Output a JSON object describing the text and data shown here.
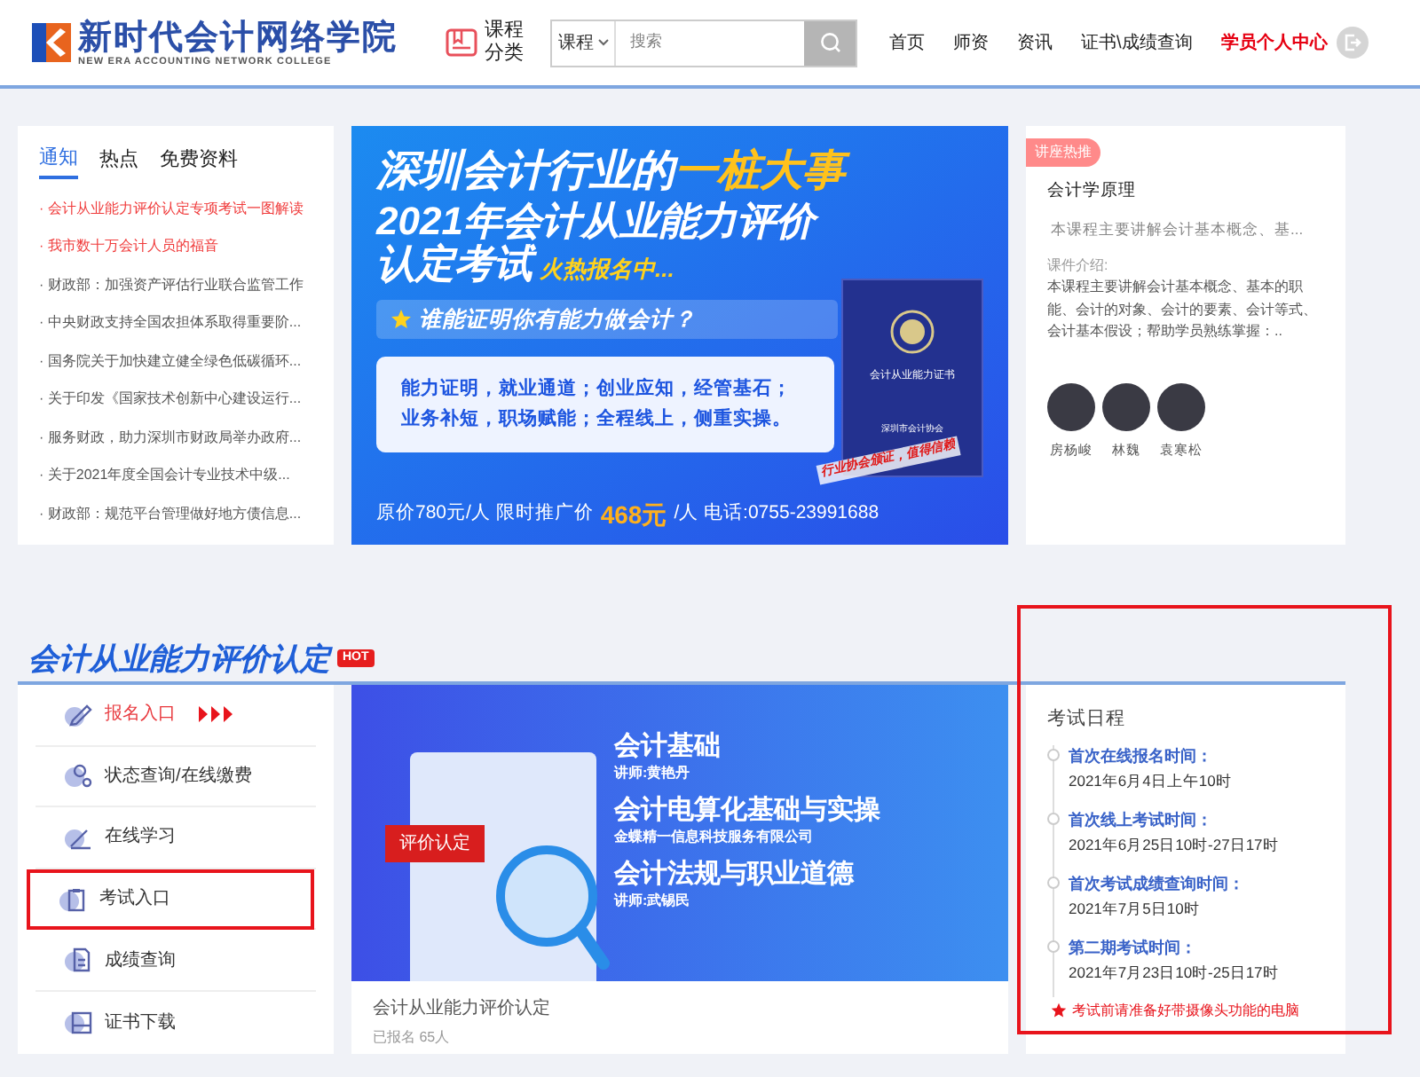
{
  "header": {
    "logo": {
      "name": "新时代会计网络学院",
      "subtitle": "NEW ERA ACCOUNTING NETWORK COLLEGE"
    },
    "category_button": {
      "lines": [
        "课程",
        "分类"
      ]
    },
    "search": {
      "scope": "课程",
      "placeholder": "搜索"
    },
    "nav": [
      {
        "label": "首页",
        "kind": "link"
      },
      {
        "label": "师资",
        "kind": "link"
      },
      {
        "label": "资讯",
        "kind": "link"
      },
      {
        "label": "证书\\成绩查询",
        "kind": "link"
      },
      {
        "label": "学员个人中心",
        "kind": "user"
      }
    ]
  },
  "news": {
    "tabs": [
      {
        "label": "通知",
        "selected": true
      },
      {
        "label": "热点",
        "selected": false
      },
      {
        "label": "免费资料",
        "selected": false
      }
    ],
    "items": [
      {
        "text": "· 会计从业能力评价认定专项考试一图解读",
        "hot": true
      },
      {
        "text": "· 我市数十万会计人员的福音",
        "hot": true
      },
      {
        "text": "· 财政部：加强资产评估行业联合监管工作",
        "hot": false
      },
      {
        "text": "· 中央财政支持全国农担体系取得重要阶...",
        "hot": false
      },
      {
        "text": "· 国务院关于加快建立健全绿色低碳循环...",
        "hot": false
      },
      {
        "text": "· 关于印发《国家技术创新中心建设运行...",
        "hot": false
      },
      {
        "text": "· 服务财政，助力深圳市财政局举办政府...",
        "hot": false
      },
      {
        "text": "· 关于2021年度全国会计专业技术中级...",
        "hot": false
      },
      {
        "text": "· 财政部：规范平台管理做好地方债信息...",
        "hot": false
      }
    ]
  },
  "banner": {
    "headline": "深圳会计行业的",
    "headline_highlight": "一桩大事",
    "line2": "2021年会计从业能力评价",
    "line3": "认定考试",
    "line3_tag": "火热报名中...",
    "question": "谁能证明你有能力做会计？",
    "benefits": [
      "能力证明，就业通道；创业应知，经管基石；",
      "业务补短，职场赋能；全程线上，侧重实操。"
    ],
    "price_before": "原价780元/人 限时推广价",
    "price_highlight": "468元",
    "price_after": "/人 电话:0755-23991688",
    "certificate": {
      "title": "会计从业能力证书",
      "issuer": "深圳市会计协会"
    },
    "stamp": "行业协会颁证，值得信赖"
  },
  "lecture": {
    "tag": "讲座热推",
    "title": "会计学原理",
    "summary": "本课程主要讲解会计基本概念、基...",
    "intro_label": "课件介绍:",
    "intro": "本课程主要讲解会计基本概念、基本的职能、会计的对象、会计的要素、会计等式、会计基本假设；帮助学员熟练掌握：..",
    "teachers": [
      "房杨峻",
      "林魏",
      "袁寒松"
    ]
  },
  "section": {
    "title": "会计从业能力评价认定",
    "badge": "HOT",
    "menu": [
      {
        "label": "报名入口",
        "kind": "primary",
        "highlighted": false
      },
      {
        "label": "状态查询/在线缴费",
        "kind": "normal",
        "highlighted": false
      },
      {
        "label": "在线学习",
        "kind": "normal",
        "highlighted": false
      },
      {
        "label": "考试入口",
        "kind": "normal",
        "highlighted": true
      },
      {
        "label": "成绩查询",
        "kind": "normal",
        "highlighted": false
      },
      {
        "label": "证书下载",
        "kind": "normal",
        "highlighted": false
      }
    ],
    "course": {
      "tag": "评价认定",
      "lines": [
        {
          "title": "会计基础",
          "subtitle": "讲师:黄艳丹"
        },
        {
          "title": "会计电算化基础与实操",
          "subtitle": "金蝶精一信息科技服务有限公司"
        },
        {
          "title": "会计法规与职业道德",
          "subtitle": "讲师:武锡民"
        }
      ],
      "name": "会计从业能力评价认定",
      "enrolled": "已报名 65人"
    },
    "schedule": {
      "title": "考试日程",
      "highlighted": true,
      "items": [
        {
          "label": "首次在线报名时间：",
          "value": "2021年6月4日上午10时"
        },
        {
          "label": "首次线上考试时间：",
          "value": "2021年6月25日10时-27日17时"
        },
        {
          "label": "首次考试成绩查询时间：",
          "value": "2021年7月5日10时"
        },
        {
          "label": "第二期考试时间：",
          "value": "2021年7月23日10时-25日17时"
        }
      ],
      "note": "考试前请准备好带摄像头功能的电脑"
    }
  }
}
